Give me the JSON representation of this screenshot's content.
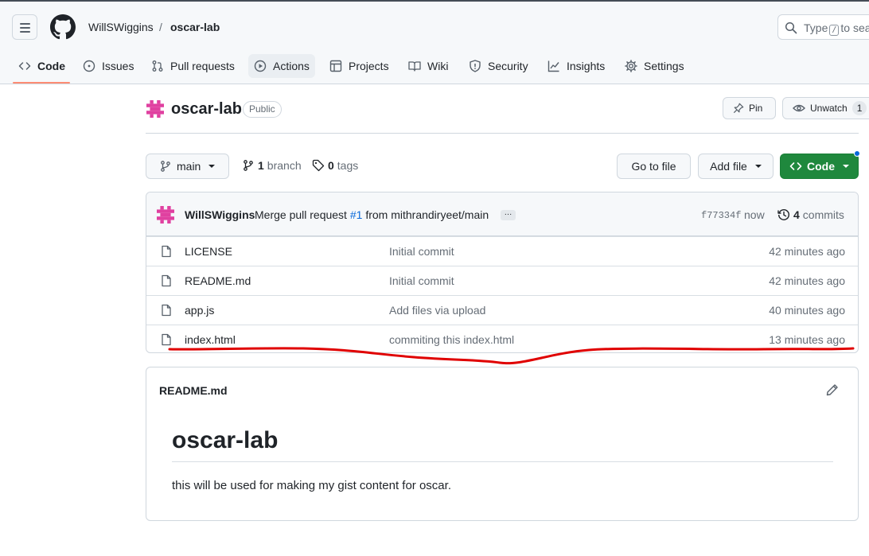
{
  "header": {
    "owner": "WillSWiggins",
    "separator": "/",
    "repo": "oscar-lab",
    "search_prefix": "Type",
    "search_key": "/",
    "search_suffix": "to sea"
  },
  "tabs": [
    {
      "label": "Code",
      "icon": "code-icon"
    },
    {
      "label": "Issues",
      "icon": "issue-icon"
    },
    {
      "label": "Pull requests",
      "icon": "pull-request-icon"
    },
    {
      "label": "Actions",
      "icon": "play-icon"
    },
    {
      "label": "Projects",
      "icon": "table-icon"
    },
    {
      "label": "Wiki",
      "icon": "book-icon"
    },
    {
      "label": "Security",
      "icon": "shield-icon"
    },
    {
      "label": "Insights",
      "icon": "graph-icon"
    },
    {
      "label": "Settings",
      "icon": "gear-icon"
    }
  ],
  "repo_header": {
    "name": "oscar-lab",
    "visibility": "Public",
    "pin_label": "Pin",
    "watch_label": "Unwatch",
    "watch_count": "1"
  },
  "file_nav": {
    "branch": "main",
    "branch_count": "1",
    "branch_label": "branch",
    "tag_count": "0",
    "tag_label": "tags",
    "goto_label": "Go to file",
    "add_file_label": "Add file",
    "code_label": "Code"
  },
  "latest_commit": {
    "author": "WillSWiggins",
    "message_prefix": "Merge pull request",
    "pr_link": "#1",
    "message_suffix": "from mithrandiryeet/main",
    "ellipsis": "…",
    "sha": "f77334f",
    "time": "now",
    "commit_count": "4",
    "commit_label": "commits"
  },
  "files": [
    {
      "name": "LICENSE",
      "message": "Initial commit",
      "age": "42 minutes ago"
    },
    {
      "name": "README.md",
      "message": "Initial commit",
      "age": "42 minutes ago"
    },
    {
      "name": "app.js",
      "message": "Add files via upload",
      "age": "40 minutes ago"
    },
    {
      "name": "index.html",
      "message": "commiting this index.html",
      "age": "13 minutes ago"
    }
  ],
  "readme": {
    "filename": "README.md",
    "heading": "oscar-lab",
    "body": "this will be used for making my gist content for oscar."
  },
  "colors": {
    "accent_underline": "#fd8c73",
    "code_button": "#1f883d",
    "link": "#0969da",
    "identicon": "#e040a0",
    "annotation": "#e00000"
  }
}
